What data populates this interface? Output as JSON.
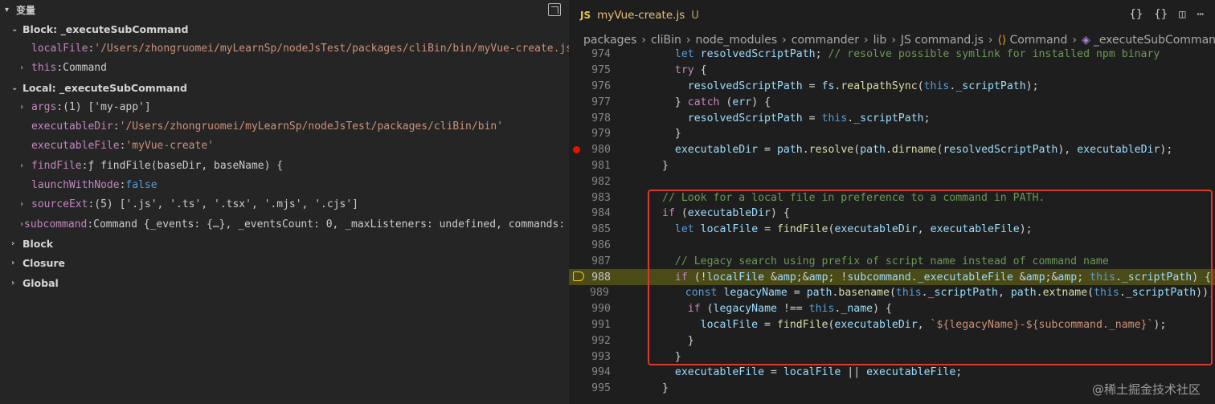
{
  "variables": {
    "title": "变量",
    "scopes": [
      {
        "label": "Block: _executeSubCommand",
        "expanded": true
      },
      {
        "label": "Local: _executeSubCommand",
        "expanded": true
      },
      {
        "label": "Block",
        "expanded": false
      },
      {
        "label": "Closure",
        "expanded": false
      },
      {
        "label": "Global",
        "expanded": false
      }
    ],
    "block_vars": [
      {
        "name": "localFile",
        "value": "'/Users/zhongruomei/myLearnSp/nodeJsTest/packages/cliBin/bin/myVue-create.js'"
      },
      {
        "name": "this",
        "value": "Command"
      }
    ],
    "local_vars": [
      {
        "name": "args",
        "value": "(1) ['my-app']"
      },
      {
        "name": "executableDir",
        "value": "'/Users/zhongruomei/myLearnSp/nodeJsTest/packages/cliBin/bin'"
      },
      {
        "name": "executableFile",
        "value": "'myVue-create'"
      },
      {
        "name": "findFile",
        "value": "ƒ findFile(baseDir, baseName) {"
      },
      {
        "name": "launchWithNode",
        "value": "false"
      },
      {
        "name": "sourceExt",
        "value": "(5) ['.js', '.ts', '.tsx', '.mjs', '.cjs']"
      },
      {
        "name": "subcommand",
        "value": "Command {_events: {…}, _eventsCount: 0, _maxListeners: undefined, commands: Arr…"
      }
    ]
  },
  "editor": {
    "tab": {
      "badge": "JS",
      "filename": "myVue-create.js",
      "status": "U"
    },
    "actions": [
      "{}",
      "{}",
      "split-icon",
      "more-icon"
    ],
    "breadcrumb": [
      "packages",
      "cliBin",
      "node_modules",
      "commander",
      "lib",
      "JS command.js",
      "Command",
      "_executeSubCommand"
    ],
    "lines": [
      {
        "n": "974",
        "text": "  let resolvedScriptPath; // resolve possible symlink for installed npm binary"
      },
      {
        "n": "975",
        "text": "  try {"
      },
      {
        "n": "976",
        "text": "    resolvedScriptPath = fs.realpathSync(this._scriptPath);"
      },
      {
        "n": "977",
        "text": "  } catch (err) {"
      },
      {
        "n": "978",
        "text": "    resolvedScriptPath = this._scriptPath;"
      },
      {
        "n": "979",
        "text": "  }"
      },
      {
        "n": "980",
        "text": "  executableDir = path.resolve(path.dirname(resolvedScriptPath), executableDir);"
      },
      {
        "n": "981",
        "text": "}"
      },
      {
        "n": "982",
        "text": ""
      },
      {
        "n": "983",
        "text": "// Look for a local file in preference to a command in PATH."
      },
      {
        "n": "984",
        "text": "if (executableDir) {"
      },
      {
        "n": "985",
        "text": "  let localFile = findFile(executableDir, executableFile);"
      },
      {
        "n": "986",
        "text": ""
      },
      {
        "n": "987",
        "text": "  // Legacy search using prefix of script name instead of command name"
      },
      {
        "n": "988",
        "text": "  if (!localFile && !subcommand._executableFile && this._scriptPath) {"
      },
      {
        "n": "989",
        "text": "    const legacyName = path.basename(this._scriptPath, path.extname(this._scriptPath));"
      },
      {
        "n": "990",
        "text": "    if (legacyName !== this._name) {"
      },
      {
        "n": "991",
        "text": "      localFile = findFile(executableDir, `${legacyName}-${subcommand._name}`);"
      },
      {
        "n": "992",
        "text": "    }"
      },
      {
        "n": "993",
        "text": "  }"
      },
      {
        "n": "994",
        "text": "  executableFile = localFile || executableFile;"
      },
      {
        "n": "995",
        "text": "}"
      }
    ],
    "breakpoint_line": "980",
    "current_line": "988"
  },
  "watermark": "@稀土掘金技术社区"
}
